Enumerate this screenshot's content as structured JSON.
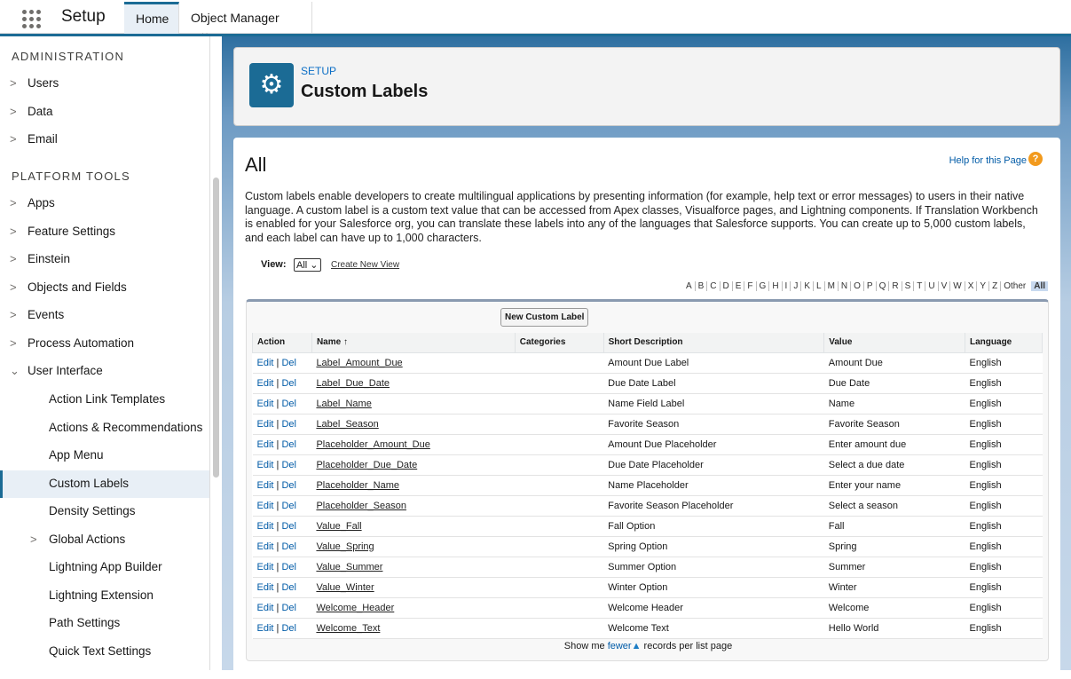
{
  "topbar": {
    "app_title": "Setup",
    "tabs": [
      "Home",
      "Object Manager"
    ]
  },
  "sidebar": {
    "sections": [
      "ADMINISTRATION",
      "PLATFORM TOOLS"
    ],
    "admin_items": [
      "Users",
      "Data",
      "Email"
    ],
    "platform_items": [
      "Apps",
      "Feature Settings",
      "Einstein",
      "Objects and Fields",
      "Events",
      "Process Automation",
      "User Interface"
    ],
    "ui_subitems": [
      "Action Link Templates",
      "Actions & Recommendations",
      "App Menu",
      "Custom Labels",
      "Density Settings",
      "Global Actions",
      "Lightning App Builder",
      "Lightning Extension",
      "Path Settings",
      "Quick Text Settings"
    ]
  },
  "header": {
    "breadcrumb": "SETUP",
    "title": "Custom Labels"
  },
  "content": {
    "title": "All",
    "help": "Help for this Page",
    "description": "Custom labels enable developers to create multilingual applications by presenting information (for example, help text or error messages) to users in their native language. A custom label is a custom text value that can be accessed from Apex classes, Visualforce pages, and Lightning components. If Translation Workbench is enabled for your Salesforce org, you can translate these labels into any of the languages that Salesforce supports. You can create up to 5,000 custom labels, and each label can have up to 1,000 characters.",
    "view_label": "View:",
    "view_value": "All",
    "create_view": "Create New View",
    "alphabet": [
      "A",
      "B",
      "C",
      "D",
      "E",
      "F",
      "G",
      "H",
      "I",
      "J",
      "K",
      "L",
      "M",
      "N",
      "O",
      "P",
      "Q",
      "R",
      "S",
      "T",
      "U",
      "V",
      "W",
      "X",
      "Y",
      "Z",
      "Other",
      "All"
    ],
    "new_button": "New Custom Label",
    "columns": [
      "Action",
      "Name ↑",
      "Categories",
      "Short Description",
      "Value",
      "Language"
    ],
    "edit": "Edit",
    "del": "Del",
    "rows": [
      [
        "Label_Amount_Due",
        "",
        "Amount Due Label",
        "Amount Due",
        "English"
      ],
      [
        "Label_Due_Date",
        "",
        "Due Date Label",
        "Due Date",
        "English"
      ],
      [
        "Label_Name",
        "",
        "Name Field Label",
        "Name",
        "English"
      ],
      [
        "Label_Season",
        "",
        "Favorite Season",
        "Favorite Season",
        "English"
      ],
      [
        "Placeholder_Amount_Due",
        "",
        "Amount Due Placeholder",
        "Enter amount due",
        "English"
      ],
      [
        "Placeholder_Due_Date",
        "",
        "Due Date Placeholder",
        "Select a due date",
        "English"
      ],
      [
        "Placeholder_Name",
        "",
        "Name Placeholder",
        "Enter your name",
        "English"
      ],
      [
        "Placeholder_Season",
        "",
        "Favorite Season Placeholder",
        "Select a season",
        "English"
      ],
      [
        "Value_Fall",
        "",
        "Fall Option",
        "Fall",
        "English"
      ],
      [
        "Value_Spring",
        "",
        "Spring Option",
        "Spring",
        "English"
      ],
      [
        "Value_Summer",
        "",
        "Summer Option",
        "Summer",
        "English"
      ],
      [
        "Value_Winter",
        "",
        "Winter Option",
        "Winter",
        "English"
      ],
      [
        "Welcome_Header",
        "",
        "Welcome Header",
        "Welcome",
        "English"
      ],
      [
        "Welcome_Text",
        "",
        "Welcome Text",
        "Hello World",
        "English"
      ]
    ],
    "footer": {
      "pre": "Show me",
      "link": "fewer",
      "post": "records per list page"
    }
  }
}
